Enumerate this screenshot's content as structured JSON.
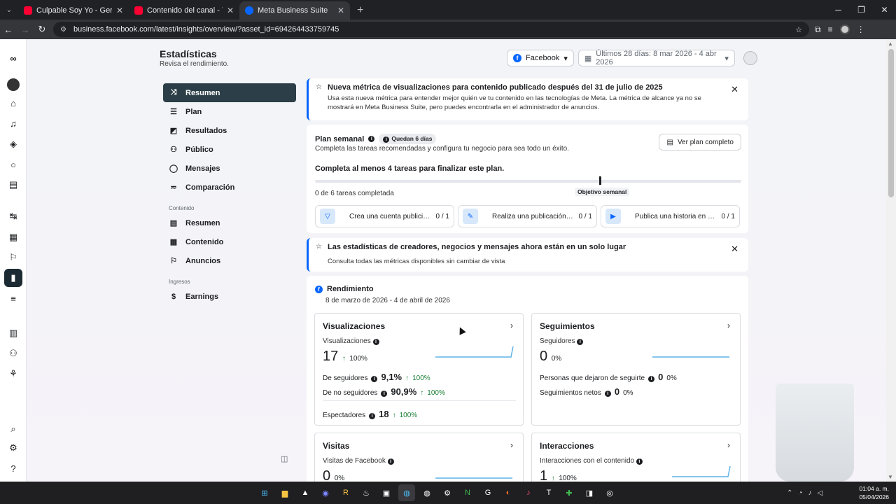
{
  "browser": {
    "tabs": [
      {
        "title": "Culpable Soy Yo - Gera MX (Vid",
        "fav_color": "#ff0033"
      },
      {
        "title": "Contenido del canal - YouTube",
        "fav_color": "#ff0033"
      },
      {
        "title": "Meta Business Suite",
        "fav_color": "#0866ff"
      }
    ],
    "url": "business.facebook.com/latest/insights/overview/?asset_id=694264433759745"
  },
  "header": {
    "title": "Estadísticas",
    "subtitle": "Revisa el rendimiento.",
    "platform": "Facebook",
    "date_range": "Últimos 28 días: 8 mar 2026 - 4 abr 2026"
  },
  "nav": {
    "items": [
      {
        "label": "Resumen",
        "icon": "overview-icon",
        "glyph": "⤨"
      },
      {
        "label": "Plan",
        "icon": "list-icon",
        "glyph": "☰"
      },
      {
        "label": "Resultados",
        "icon": "chart-icon",
        "glyph": "◩"
      },
      {
        "label": "Público",
        "icon": "people-icon",
        "glyph": "⚇"
      },
      {
        "label": "Mensajes",
        "icon": "chat-icon",
        "glyph": "◯"
      },
      {
        "label": "Comparación",
        "icon": "compare-icon",
        "glyph": "≂"
      }
    ],
    "section_content": "Contenido",
    "content_items": [
      {
        "label": "Resumen",
        "icon": "grid-icon",
        "glyph": "▤"
      },
      {
        "label": "Contenido",
        "icon": "table-icon",
        "glyph": "▦"
      },
      {
        "label": "Anuncios",
        "icon": "megaphone-icon",
        "glyph": "⚐"
      }
    ],
    "section_income": "Ingresos",
    "income_items": [
      {
        "label": "Earnings",
        "icon": "dollar-icon",
        "glyph": "$"
      }
    ]
  },
  "banner1": {
    "title": "Nueva métrica de visualizaciones para contenido publicado después del 31 de julio de 2025",
    "body": "Usa esta nueva métrica para entender mejor quién ve tu contenido en las tecnologías de Meta. La métrica de alcance ya no se mostrará en Meta Business Suite, pero puedes encontrarla en el administrador de anuncios."
  },
  "plan": {
    "title": "Plan semanal",
    "pill": "Quedan 6 días",
    "subtitle": "Completa las tareas recomendadas y configura tu negocio para sea todo un éxito.",
    "button": "Ver plan completo",
    "goal": "Completa al menos 4 tareas para finalizar este plan.",
    "progress": 0,
    "objective_label": "Objetivo semanal",
    "completed": "0 de 6 tareas completada",
    "tasks": [
      {
        "label": "Crea una cuenta publicitaria",
        "count": "0 / 1"
      },
      {
        "label": "Realiza una publicación en Fa...",
        "count": "0 / 1"
      },
      {
        "label": "Publica una historia en Faceb...",
        "count": "0 / 1"
      }
    ]
  },
  "banner2": {
    "title": "Las estadísticas de creadores, negocios y mensajes ahora están en un solo lugar",
    "body": "Consulta todas las métricas disponibles sin cambiar de vista"
  },
  "performance": {
    "title": "Rendimiento",
    "range": "8 de marzo de 2026 - 4 de abril de 2026",
    "views": {
      "title": "Visualizaciones",
      "metric_label": "Visualizaciones",
      "value": "17",
      "change": "100%",
      "followers_label": "De seguidores",
      "followers_value": "9,1%",
      "followers_change": "100%",
      "nonfollowers_label": "De no seguidores",
      "nonfollowers_value": "90,9%",
      "nonfollowers_change": "100%",
      "viewers_label": "Espectadores",
      "viewers_value": "18",
      "viewers_change": "100%"
    },
    "followers": {
      "title": "Seguimientos",
      "metric_label": "Seguidores",
      "value": "0",
      "change": "0%",
      "unfollow_label": "Personas que dejaron de seguirte",
      "unfollow_value": "0",
      "unfollow_change": "0%",
      "net_label": "Seguimientos netos",
      "net_value": "0",
      "net_change": "0%"
    },
    "visits": {
      "title": "Visitas",
      "metric_label": "Visitas de Facebook",
      "value": "0",
      "change": "0%"
    },
    "interactions": {
      "title": "Interacciones",
      "metric_label": "Interacciones con el contenido",
      "value": "1",
      "change": "100%"
    }
  },
  "clock": {
    "time": "01:04 a. m.",
    "date": "05/04/2026"
  }
}
